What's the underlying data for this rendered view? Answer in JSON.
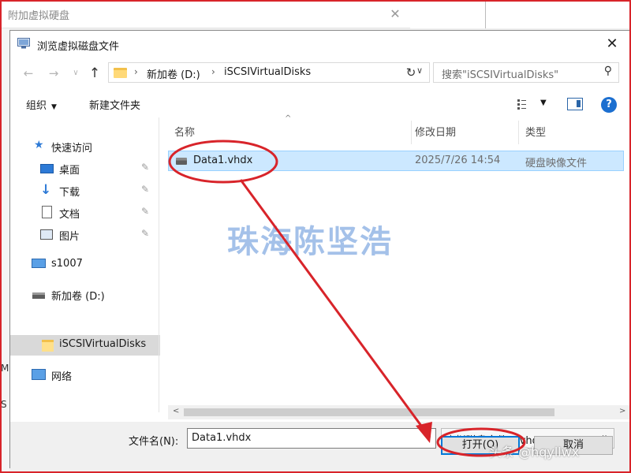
{
  "background": {
    "window_title": "附加虚拟硬盘",
    "close_glyph": "✕",
    "left_marks": [
      "M",
      "S"
    ]
  },
  "dialog": {
    "title": "浏览虚拟磁盘文件",
    "close_glyph": "✕"
  },
  "navbar": {
    "back_glyph": "←",
    "forward_glyph": "→",
    "recent_glyph": "∨",
    "up_glyph": "↑",
    "path_sep": "›",
    "path": [
      "新加卷 (D:)",
      "iSCSIVirtualDisks"
    ],
    "dropdown_glyph": "∨",
    "refresh_glyph": "↻",
    "search_placeholder": "搜索\"iSCSIVirtualDisks\"",
    "search_glyph": "⚲"
  },
  "toolbar": {
    "organize": "组织",
    "new_folder": "新建文件夹",
    "caret": "▼",
    "help": "?"
  },
  "sidebar": {
    "quick_access": "快速访问",
    "desktop": "桌面",
    "downloads": "下载",
    "documents": "文档",
    "pictures": "图片",
    "pc": "s1007",
    "drive": "新加卷 (D:)",
    "folder": "iSCSIVirtualDisks",
    "network": "网络",
    "pin_glyph": "✎"
  },
  "filelist": {
    "columns": [
      "名称",
      "修改日期",
      "类型"
    ],
    "sort_glyph": "^",
    "rows": [
      {
        "name": "Data1.vhdx",
        "modified": "2025/7/26 14:54",
        "type": "硬盘映像文件"
      }
    ]
  },
  "watermark": "珠海陈坚浩",
  "scroll": {
    "left_glyph": "<",
    "right_glyph": ">"
  },
  "bottom": {
    "filename_label": "文件名(N):",
    "filename_value": "Data1.vhdx",
    "filetype_value": "虚拟磁盘文件(*.vhd、*.vhdx)",
    "filetype_caret": "∨",
    "open_button": "打开(O)",
    "cancel_button": "取消"
  },
  "corner_watermark": "头条 @hqyllwx",
  "colors": {
    "annotation_red": "#d8242a",
    "selection": "#cce8ff",
    "accent_blue": "#0078d7"
  }
}
